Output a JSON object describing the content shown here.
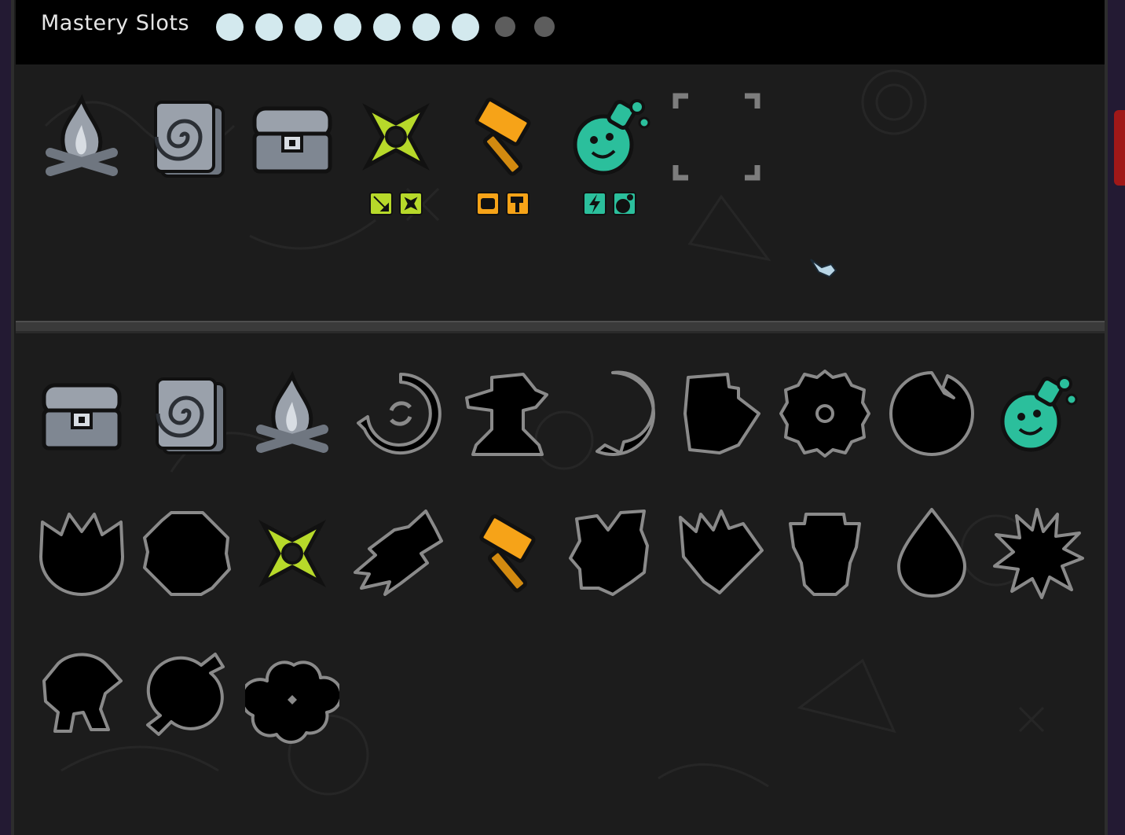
{
  "header": {
    "title": "Mastery Slots",
    "slots_total": 9,
    "slots_filled": 7
  },
  "colors": {
    "slot_filled": "#d3e9ee",
    "slot_empty": "#5d5d5d",
    "shuriken": "#b7d92a",
    "hammer": "#f6a318",
    "potion": "#2bbf9c",
    "stone": "#9aa1ab",
    "silhouette_outline": "#8a8a8a"
  },
  "equipped": [
    {
      "icon": "campfire-icon"
    },
    {
      "icon": "vortex-card-icon"
    },
    {
      "icon": "treasure-chest-icon"
    },
    {
      "icon": "shuriken-icon",
      "sub_icons": [
        "kunai-badge-icon",
        "shuriken-badge-icon"
      ]
    },
    {
      "icon": "hammer-icon",
      "sub_icons": [
        "fist-badge-icon",
        "hammer-badge-icon"
      ]
    },
    {
      "icon": "potion-icon",
      "sub_icons": [
        "lightning-badge-icon",
        "potion-badge-icon"
      ]
    },
    {
      "icon": "empty-slot-bracket-icon"
    }
  ],
  "collection": [
    {
      "icon": "treasure-chest-icon",
      "locked": false
    },
    {
      "icon": "vortex-card-icon",
      "locked": false
    },
    {
      "icon": "campfire-icon",
      "locked": false
    },
    {
      "icon": "locked-refresh-silhouette-icon",
      "locked": true
    },
    {
      "icon": "locked-anvil-silhouette-icon",
      "locked": true
    },
    {
      "icon": "locked-orb-silhouette-icon",
      "locked": true
    },
    {
      "icon": "locked-book-silhouette-icon",
      "locked": true
    },
    {
      "icon": "locked-gear-silhouette-icon",
      "locked": true
    },
    {
      "icon": "locked-moon-silhouette-icon",
      "locked": true
    },
    {
      "icon": "potion-icon",
      "locked": false
    },
    {
      "icon": "locked-flower-silhouette-icon",
      "locked": true
    },
    {
      "icon": "locked-octagon-silhouette-icon",
      "locked": true
    },
    {
      "icon": "shuriken-icon",
      "locked": false
    },
    {
      "icon": "locked-leaf-silhouette-icon",
      "locked": true
    },
    {
      "icon": "hammer-icon",
      "locked": false
    },
    {
      "icon": "locked-claw-silhouette-icon",
      "locked": true
    },
    {
      "icon": "locked-flame-silhouette-icon",
      "locked": true
    },
    {
      "icon": "locked-totem-silhouette-icon",
      "locked": true
    },
    {
      "icon": "locked-drop-silhouette-icon",
      "locked": true
    },
    {
      "icon": "locked-burst-silhouette-icon",
      "locked": true
    },
    {
      "icon": "locked-creature-silhouette-icon",
      "locked": true
    },
    {
      "icon": "locked-candy-silhouette-icon",
      "locked": true
    },
    {
      "icon": "locked-cloud-silhouette-icon",
      "locked": true
    }
  ]
}
